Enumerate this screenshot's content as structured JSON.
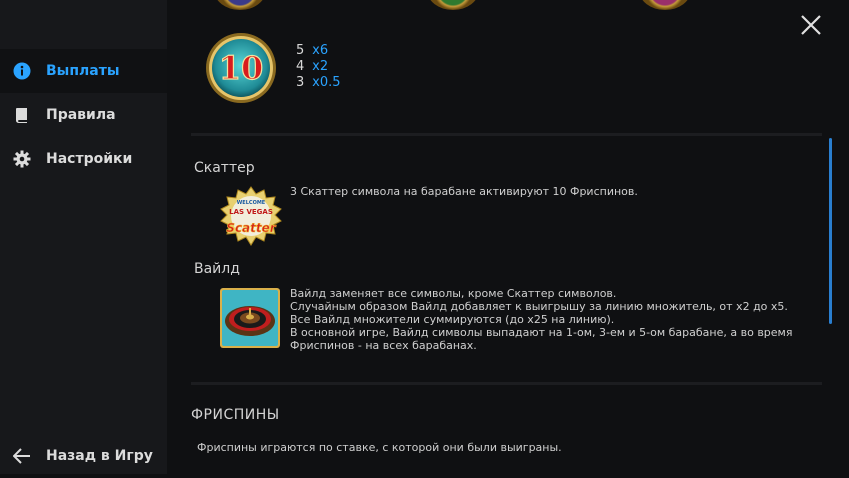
{
  "sidebar": {
    "items": [
      {
        "label": "Выплаты",
        "icon": "info-icon",
        "active": true
      },
      {
        "label": "Правила",
        "icon": "book-icon",
        "active": false
      },
      {
        "label": "Настройки",
        "icon": "gear-icon",
        "active": false
      }
    ],
    "back_label": "Назад в Игру"
  },
  "paytable": {
    "symbol_label": "10",
    "rows": [
      {
        "count": "5",
        "mult": "x6"
      },
      {
        "count": "4",
        "mult": "x2"
      },
      {
        "count": "3",
        "mult": "x0.5"
      }
    ]
  },
  "scatter": {
    "title": "Скаттер",
    "description": "3 Скаттер символа на барабане активируют 10 Фриспинов.",
    "icon_top_text": "WELCOME",
    "icon_mid_text": "LAS VEGAS",
    "icon_bottom_text": "Scatter"
  },
  "wild": {
    "title": "Вайлд",
    "lines": [
      "Вайлд заменяет все символы, кроме Скаттер символов.",
      "Случайным образом Вайлд добавляет к выигрышу за линию множитель, от x2 до x5.",
      "Все Вайлд множители суммируются (до x25 на линию).",
      "В основной игре, Вайлд символы выпадают на 1-ом, 3-ем и 5-ом барабане, а во время",
      "Фриспинов - на всех барабанах."
    ]
  },
  "freespins": {
    "title": "ФРИСПИНЫ",
    "description": "Фриспины играются по ставке, с которой они были выиграны."
  },
  "colors": {
    "accent": "#2aa3ff",
    "sidebar_bg": "#17181b",
    "main_bg": "#0f1012"
  }
}
